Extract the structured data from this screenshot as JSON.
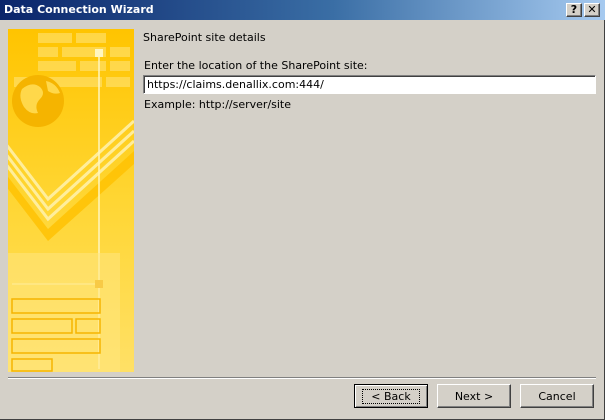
{
  "window": {
    "title": "Data Connection Wizard",
    "help_glyph": "?",
    "close_glyph": "✕"
  },
  "step": {
    "heading": "SharePoint site details",
    "location_label": "Enter the location of the SharePoint site:",
    "location_value": "https://claims.denallix.com:444/",
    "example": "Example: http://server/site"
  },
  "buttons": {
    "back": "< Back",
    "next": "Next >",
    "cancel": "Cancel"
  },
  "colors": {
    "titlebar_start": "#0a246a",
    "titlebar_end": "#a6caf0",
    "dialog_face": "#d4d0c8",
    "art_yellow": "#ffd21e"
  }
}
